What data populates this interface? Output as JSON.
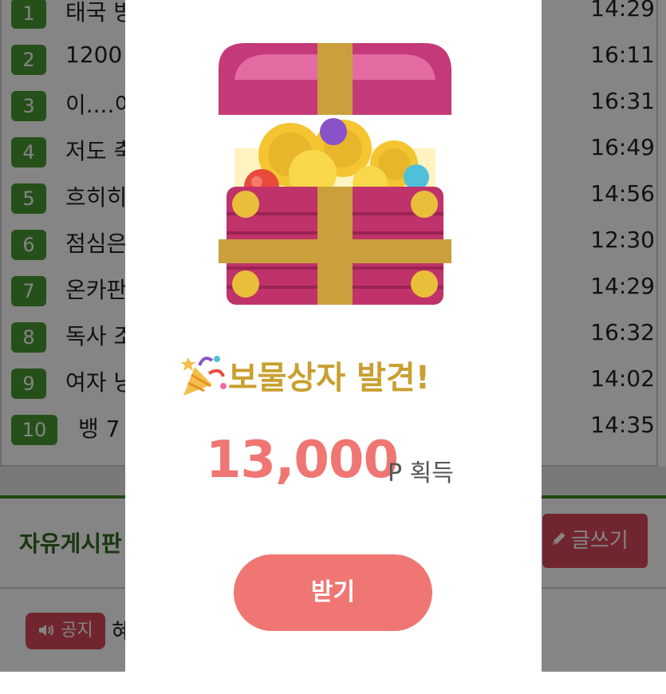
{
  "ranking": {
    "items": [
      {
        "rank": "1",
        "title": "태국 방",
        "time": "14:29"
      },
      {
        "rank": "2",
        "title": "1200",
        "time": "16:11"
      },
      {
        "rank": "3",
        "title": "이....이",
        "time": "16:31"
      },
      {
        "rank": "4",
        "title": "저도 축",
        "time": "16:49"
      },
      {
        "rank": "5",
        "title": "흐히히",
        "time": "14:56"
      },
      {
        "rank": "6",
        "title": "점심은",
        "time": "12:30"
      },
      {
        "rank": "7",
        "title": "온카판",
        "time": "14:29"
      },
      {
        "rank": "8",
        "title": "독사 조",
        "time": "16:32"
      },
      {
        "rank": "9",
        "title": "여자 냥",
        "time": "14:02"
      },
      {
        "rank": "10",
        "title": "뱅 7",
        "time": "14:35"
      }
    ]
  },
  "board": {
    "title": "자유게시판",
    "write_label": "글쓰기",
    "notice_badge": "공지",
    "notice_title": "혜"
  },
  "modal": {
    "heading": "보물상자 발견!",
    "amount": "13,000",
    "unit": "P 획득",
    "claim_label": "받기",
    "icons": [
      "treasure-chest-icon",
      "party-popper-icon",
      "speaker-icon",
      "pencil-icon"
    ]
  },
  "colors": {
    "rank_badge": "#4a9a30",
    "accent_red": "#d84a5a",
    "reward_coral": "#ef7672",
    "heading_gold": "#c9a030",
    "board_green": "#2d6a1e"
  }
}
